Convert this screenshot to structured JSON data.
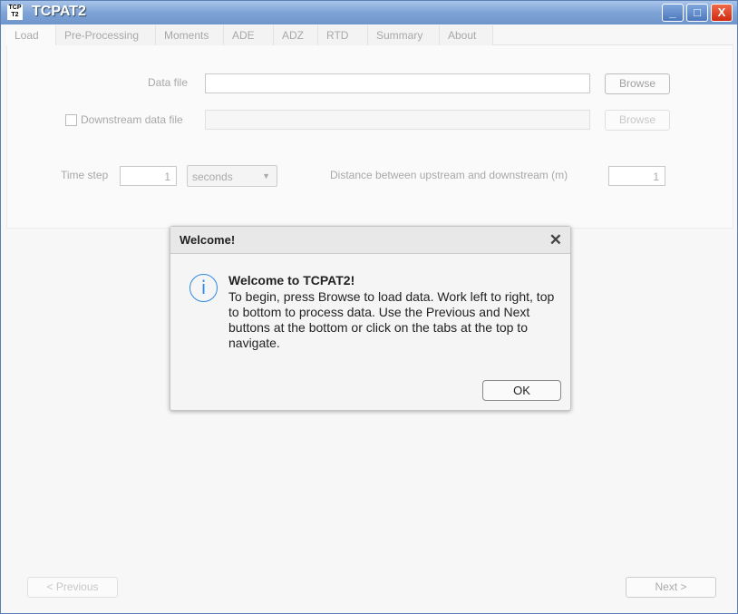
{
  "window": {
    "title": "TCPAT2",
    "icon_text": "TCP T2"
  },
  "tabs": [
    "Load",
    "Pre-Processing",
    "Moments",
    "ADE",
    "ADZ",
    "RTD",
    "Summary",
    "About"
  ],
  "load": {
    "data_file_label": "Data file",
    "data_file_value": "",
    "browse1": "Browse",
    "downstream_label": "Downstream data file",
    "downstream_checked": false,
    "downstream_value": "",
    "browse2": "Browse",
    "time_step_label": "Time step",
    "time_step_value": "1",
    "time_unit": "seconds",
    "distance_label": "Distance between upstream and downstream (m)",
    "distance_value": "1"
  },
  "nav": {
    "previous": "< Previous",
    "next": "Next >"
  },
  "dialog": {
    "title": "Welcome!",
    "heading": "Welcome to TCPAT2!",
    "message": "To begin, press Browse to load data. Work left to right, top to bottom to process data. Use the Previous and Next buttons at the bottom or click on the tabs at the top to navigate.",
    "ok": "OK",
    "icon": "info-icon"
  }
}
